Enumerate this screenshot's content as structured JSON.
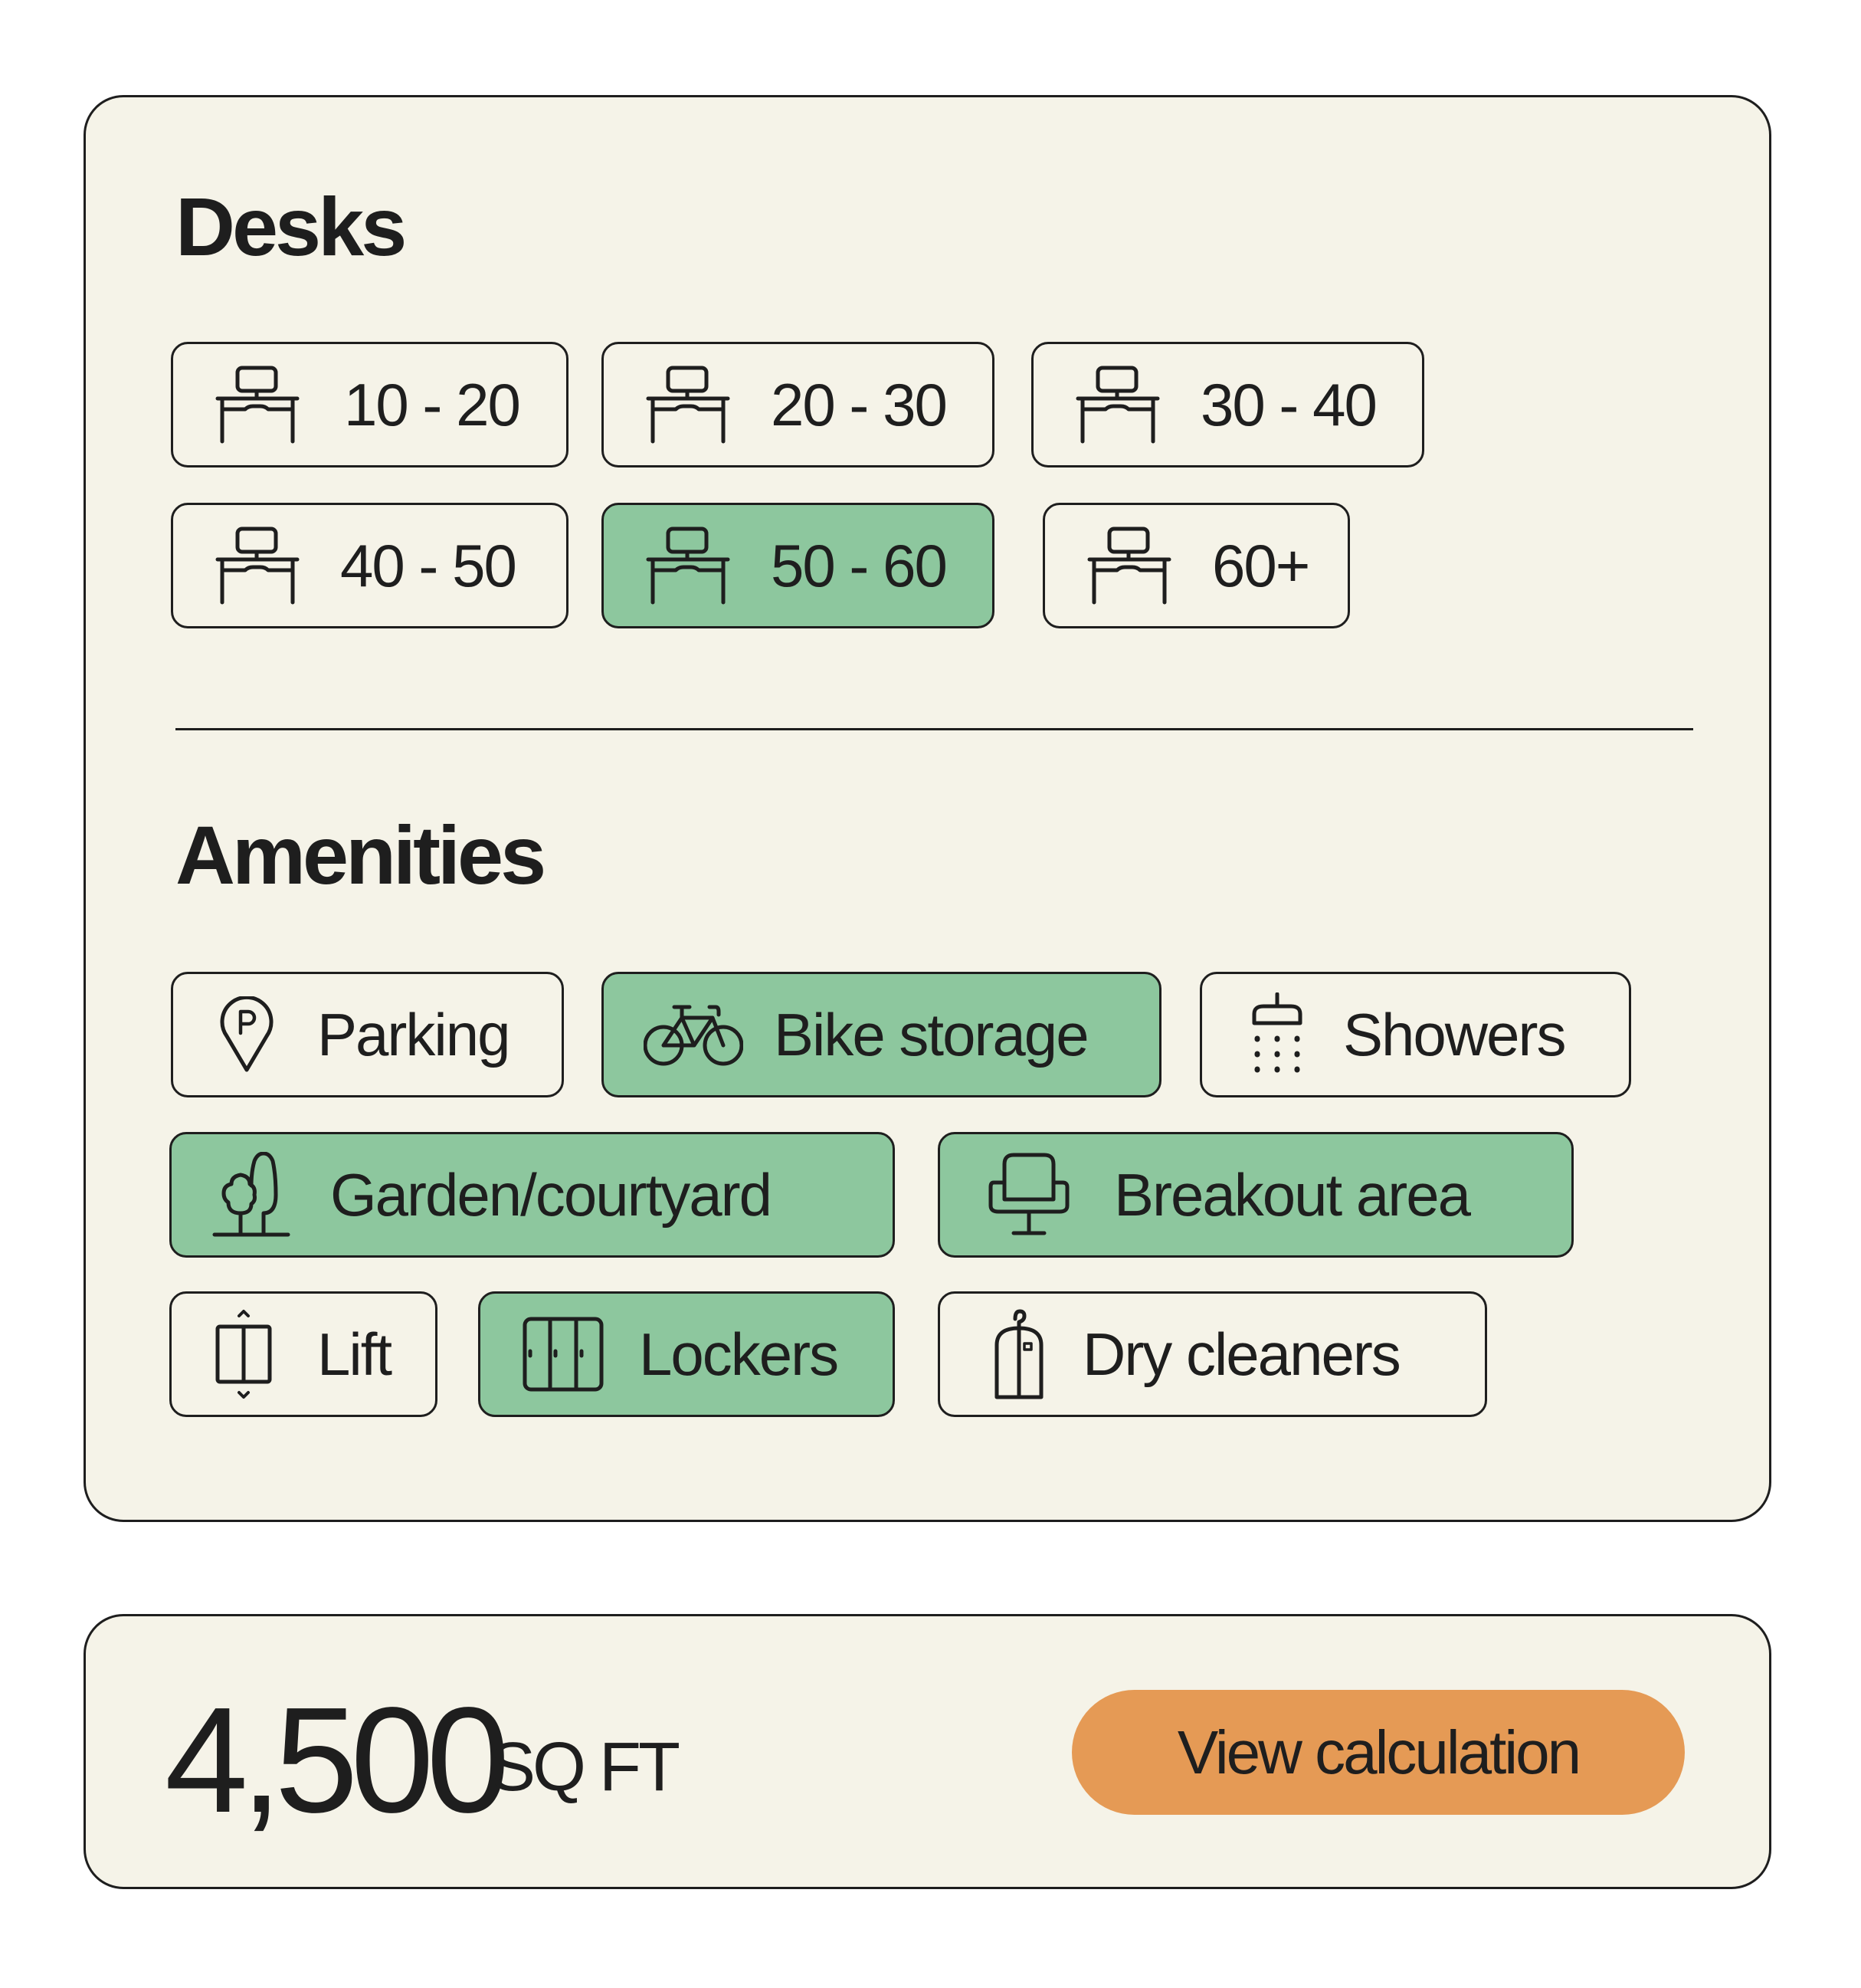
{
  "desks": {
    "heading": "Desks",
    "options": [
      {
        "label": "10 - 20",
        "icon": "desk-icon",
        "selected": false
      },
      {
        "label": "20 - 30",
        "icon": "desk-icon",
        "selected": false
      },
      {
        "label": "30 - 40",
        "icon": "desk-icon",
        "selected": false
      },
      {
        "label": "40 - 50",
        "icon": "desk-icon",
        "selected": false
      },
      {
        "label": "50 - 60",
        "icon": "desk-icon",
        "selected": true
      },
      {
        "label": "60+",
        "icon": "desk-icon",
        "selected": false
      }
    ]
  },
  "amenities": {
    "heading": "Amenities",
    "options": [
      {
        "label": "Parking",
        "icon": "parking-pin-icon",
        "selected": false
      },
      {
        "label": "Bike storage",
        "icon": "bicycle-icon",
        "selected": true
      },
      {
        "label": "Showers",
        "icon": "shower-icon",
        "selected": false
      },
      {
        "label": "Garden/courtyard",
        "icon": "trees-icon",
        "selected": true
      },
      {
        "label": "Breakout area",
        "icon": "armchair-icon",
        "selected": true
      },
      {
        "label": "Lift",
        "icon": "lift-icon",
        "selected": false
      },
      {
        "label": "Lockers",
        "icon": "lockers-icon",
        "selected": true
      },
      {
        "label": "Dry cleaners",
        "icon": "garment-bag-icon",
        "selected": false
      }
    ]
  },
  "total": {
    "value": "4,500",
    "unit": "SQ FT",
    "button_label": "View calculation"
  },
  "colors": {
    "card_background": "#f5f3e8",
    "selected": "#8dc79e",
    "accent_button": "#e59a55",
    "ink": "#1e1e1e"
  }
}
